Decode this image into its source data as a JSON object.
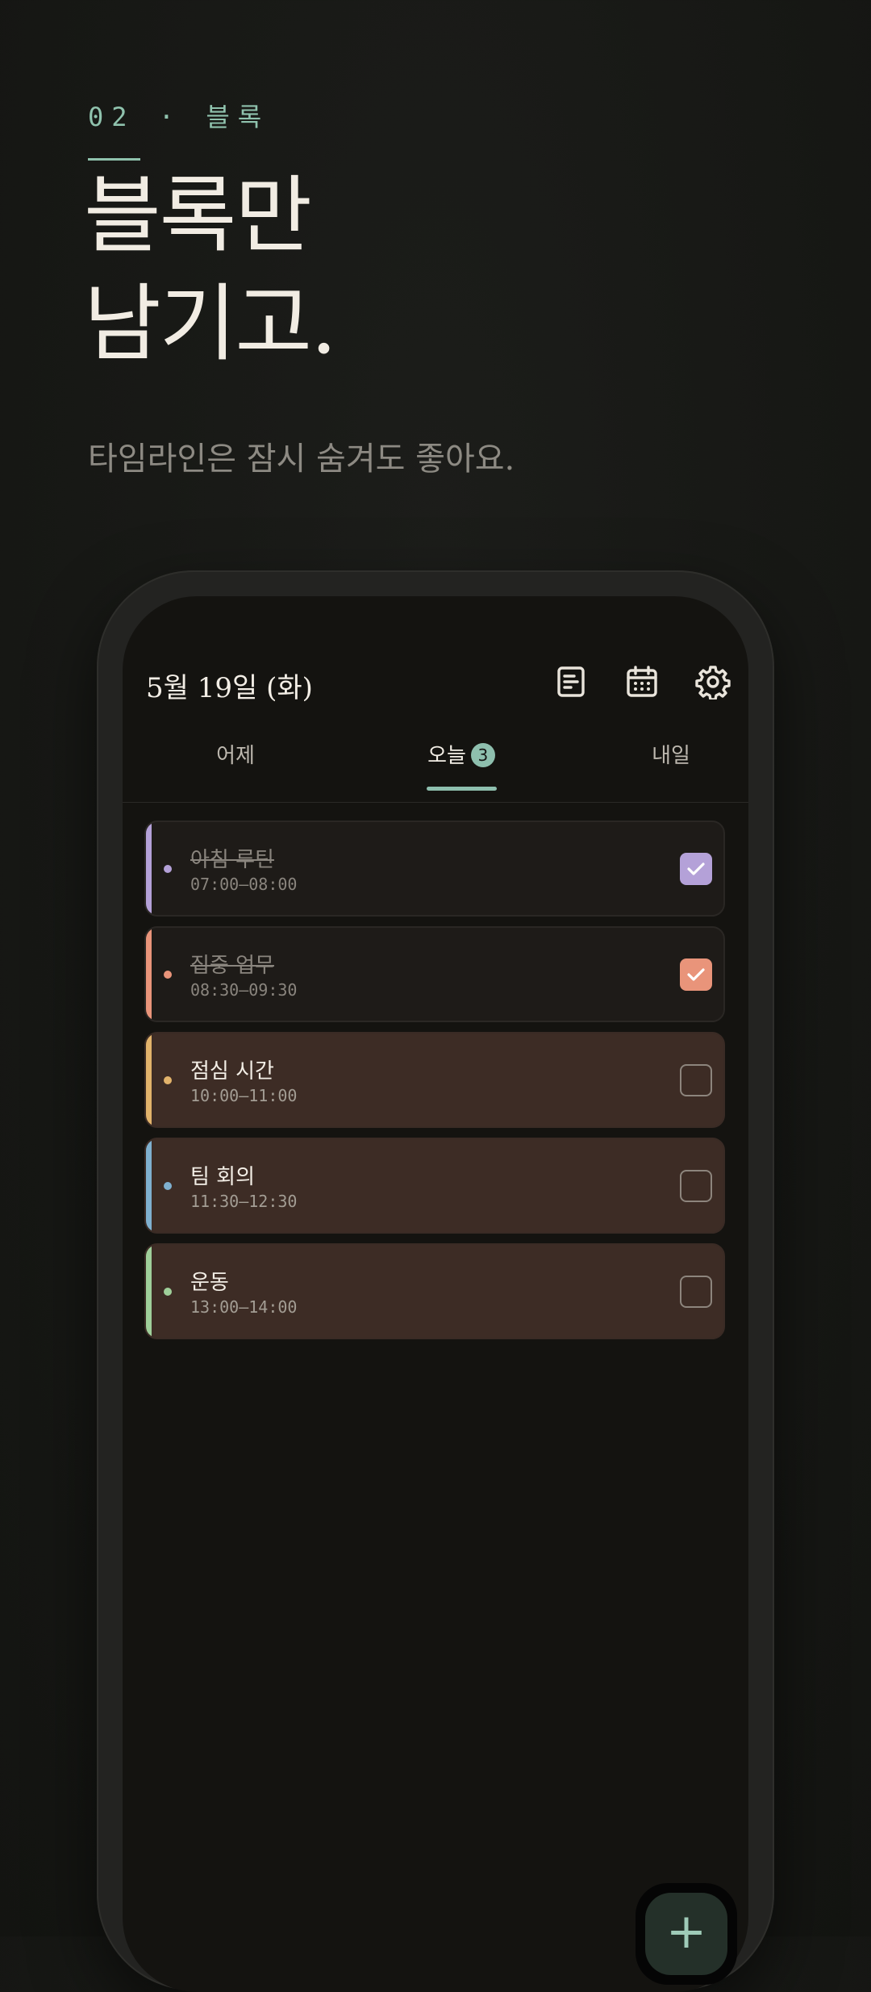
{
  "hero": {
    "eyebrow": "02 · 블록",
    "headline_line1": "블록만",
    "headline_line2": "남기고.",
    "subline": "타임라인은 잠시 숨겨도 좋아요."
  },
  "app": {
    "date": "5월 19일 (화)",
    "icons": [
      "notes-icon",
      "calendar-icon",
      "gear-icon"
    ],
    "tabs": [
      {
        "label": "어제"
      },
      {
        "label": "오늘",
        "badge": "3"
      },
      {
        "label": "내일"
      }
    ],
    "active_tab": 1,
    "blocks": [
      {
        "title": "아침 루틴",
        "time": "07:00–08:00",
        "color": "#b4a1d8",
        "done": true
      },
      {
        "title": "집중 업무",
        "time": "08:30–09:30",
        "color": "#e9947a",
        "done": true
      },
      {
        "title": "점심 시간",
        "time": "10:00–11:00",
        "color": "#e2b36b",
        "done": false
      },
      {
        "title": "팀 회의",
        "time": "11:30–12:30",
        "color": "#7fb0cf",
        "done": false
      },
      {
        "title": "운동",
        "time": "13:00–14:00",
        "color": "#9fcf9a",
        "done": false
      }
    ],
    "fab_label": "+",
    "accent": "#8ebfae"
  }
}
